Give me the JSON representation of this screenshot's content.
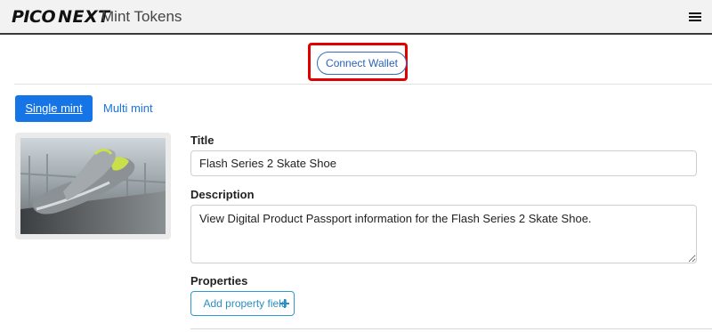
{
  "header": {
    "logo_part1": "PICO",
    "logo_part2": "NEXT",
    "app_title": "Mint Tokens",
    "menu_icon": "hamburger-icon"
  },
  "wallet": {
    "connect_label": "Connect Wallet"
  },
  "tabs": {
    "single": "Single mint",
    "multi": "Multi mint",
    "active": "Single mint"
  },
  "product": {
    "image_icon": "sneaker-photo"
  },
  "form": {
    "title_label": "Title",
    "title_value": "Flash Series 2 Skate Shoe",
    "description_label": "Description",
    "description_value": "View Digital Product Passport information for the Flash Series 2 Skate Shoe.",
    "properties_label": "Properties",
    "add_property_label": "Add property field"
  },
  "colors": {
    "primary": "#1574e6",
    "highlight": "#e00000",
    "outline_blue": "#2f9ad0"
  }
}
